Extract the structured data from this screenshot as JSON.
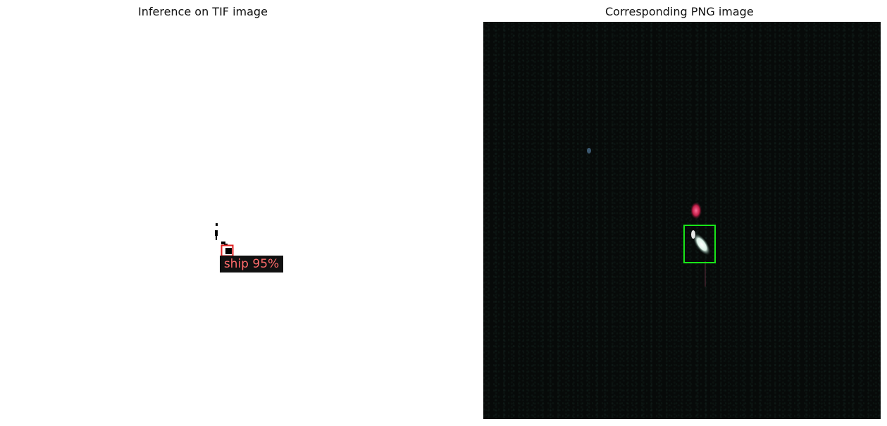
{
  "panels": [
    {
      "title": "Inference on TIF image",
      "detection": {
        "label": "ship 95%",
        "box_color": "#e02020"
      }
    },
    {
      "title": "Corresponding PNG image",
      "detection": {
        "box_color": "#19e619"
      }
    }
  ],
  "colors": {
    "tif_background": "#ffffff",
    "png_background": "#070a09",
    "label_text": "#ff6b6b",
    "label_background": "#111111",
    "ship_hotspot": "#ff3b6b"
  }
}
